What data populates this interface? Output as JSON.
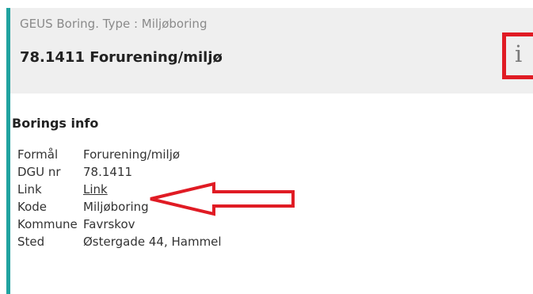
{
  "header": {
    "subtitle": "GEUS Boring. Type : Miljøboring",
    "title": "78.1411 Forurening/miljø",
    "info_icon_glyph": "i",
    "accent_color": "#20a3a0",
    "highlight_color": "#e01b24"
  },
  "section": {
    "title": "Borings info"
  },
  "rows": [
    {
      "key": "Formål",
      "value": "Forurening/miljø"
    },
    {
      "key": "DGU nr",
      "value": "78.1411"
    },
    {
      "key": "Link",
      "value": "Link"
    },
    {
      "key": "Kode",
      "value": "Miljøboring"
    },
    {
      "key": "Kommune",
      "value": "Favrskov"
    },
    {
      "key": "Sted",
      "value": "Østergade 44, Hammel"
    }
  ],
  "annotation": {
    "arrow_icon": "red-arrow-left-icon"
  }
}
